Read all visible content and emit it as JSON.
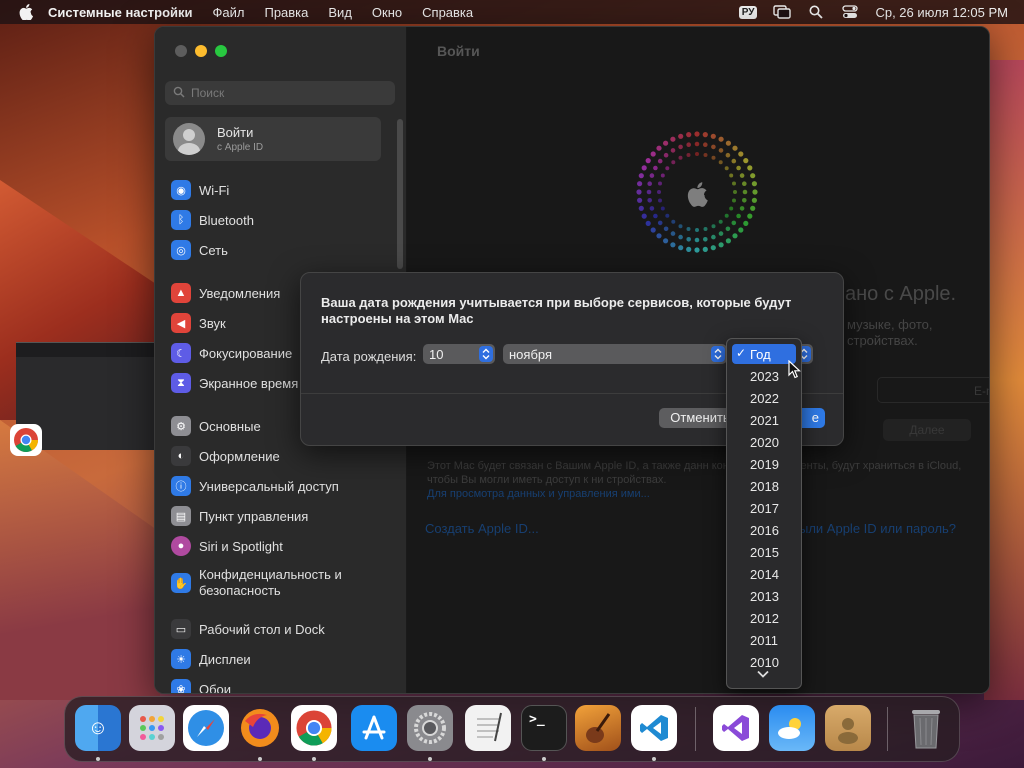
{
  "menubar": {
    "app_name": "Системные настройки",
    "menus": [
      "Файл",
      "Правка",
      "Вид",
      "Окно",
      "Справка"
    ],
    "input_lang": "РУ",
    "datetime": "Ср, 26 июля  12:05 PM"
  },
  "sidebar": {
    "search_placeholder": "Поиск",
    "account_title": "Войти",
    "account_subtitle": "с Apple ID",
    "items": [
      {
        "label": "Wi-Fi",
        "icon": "wifi-icon",
        "color": "#2f7ae6"
      },
      {
        "label": "Bluetooth",
        "icon": "bluetooth-icon",
        "color": "#2f7ae6"
      },
      {
        "label": "Сеть",
        "icon": "globe-icon",
        "color": "#2f7ae6"
      },
      {
        "label": "Уведомления",
        "icon": "bell-icon",
        "color": "#e0443a"
      },
      {
        "label": "Звук",
        "icon": "speaker-icon",
        "color": "#e0443a"
      },
      {
        "label": "Фокусирование",
        "icon": "moon-icon",
        "color": "#5e5ce6"
      },
      {
        "label": "Экранное время",
        "icon": "hourglass-icon",
        "color": "#5e5ce6"
      },
      {
        "label": "Основные",
        "icon": "gear-icon",
        "color": "#8e8e93"
      },
      {
        "label": "Оформление",
        "icon": "appearance-icon",
        "color": "#3a3a3c"
      },
      {
        "label": "Универсальный доступ",
        "icon": "accessibility-icon",
        "color": "#2f7ae6"
      },
      {
        "label": "Пункт управления",
        "icon": "control-center-icon",
        "color": "#8e8e93"
      },
      {
        "label": "Siri и Spotlight",
        "icon": "siri-icon",
        "color": "#b04aa0"
      },
      {
        "label": "Конфиденциальность и безопасность",
        "icon": "hand-icon",
        "color": "#2f7ae6"
      },
      {
        "label": "Рабочий стол и Dock",
        "icon": "dock-icon",
        "color": "#3a3a3c"
      },
      {
        "label": "Дисплеи",
        "icon": "sun-icon",
        "color": "#2f7ae6"
      },
      {
        "label": "Обои",
        "icon": "wallpaper-icon",
        "color": "#2f7ae6"
      }
    ]
  },
  "main": {
    "title": "Войти",
    "bg_heading": "ано с Apple.",
    "bg_sub": "музыке, фото, стройствах.",
    "email_placeholder": "E-mail",
    "next_label": "Далее",
    "info_text": "Этот Mac будет связан с Вашим Apple ID, а также данн                    контакты и документы, будут храниться в iCloud, чтобы Вы могли иметь доступ к ни                   стройствах.",
    "info_link": "Для просмотра данных и управления ими...",
    "create_link": "Создать Apple ID...",
    "forgot_link": "ыли Apple ID или пароль?"
  },
  "dialog": {
    "message": "Ваша дата рождения учитывается при выборе сервисов, которые будут настроены на этом Mac",
    "dob_label": "Дата рождения:",
    "day": "10",
    "month": "ноября",
    "cancel_label": "Отменить",
    "ok_label": "е"
  },
  "year_menu": {
    "selected": "Год",
    "years": [
      "2023",
      "2022",
      "2021",
      "2020",
      "2019",
      "2018",
      "2017",
      "2016",
      "2015",
      "2014",
      "2013",
      "2012",
      "2011",
      "2010"
    ]
  },
  "dock": {
    "apps": [
      {
        "name": "finder-icon",
        "color": "#3a8ee6"
      },
      {
        "name": "launchpad-icon",
        "color": "#d0d0d8"
      },
      {
        "name": "safari-icon",
        "color": "#2f8fe6"
      },
      {
        "name": "firefox-icon",
        "color": "#f28c1c"
      },
      {
        "name": "chrome-icon",
        "color": "#ffffff"
      },
      {
        "name": "app-store-icon",
        "color": "#1a8cf0"
      },
      {
        "name": "system-settings-icon",
        "color": "#8a8a8e"
      },
      {
        "name": "textedit-icon",
        "color": "#f2f2f2"
      },
      {
        "name": "terminal-icon",
        "color": "#1c1c1c"
      },
      {
        "name": "garageband-icon",
        "color": "#e0882a"
      },
      {
        "name": "vscode-icon",
        "color": "#ffffff"
      },
      {
        "name": "visual-studio-icon",
        "color": "#ffffff"
      },
      {
        "name": "weather-icon",
        "color": "#2a8cf0"
      },
      {
        "name": "contacts-icon",
        "color": "#c89a5a"
      },
      {
        "name": "trash-icon",
        "color": "#6a6a6e"
      }
    ]
  }
}
